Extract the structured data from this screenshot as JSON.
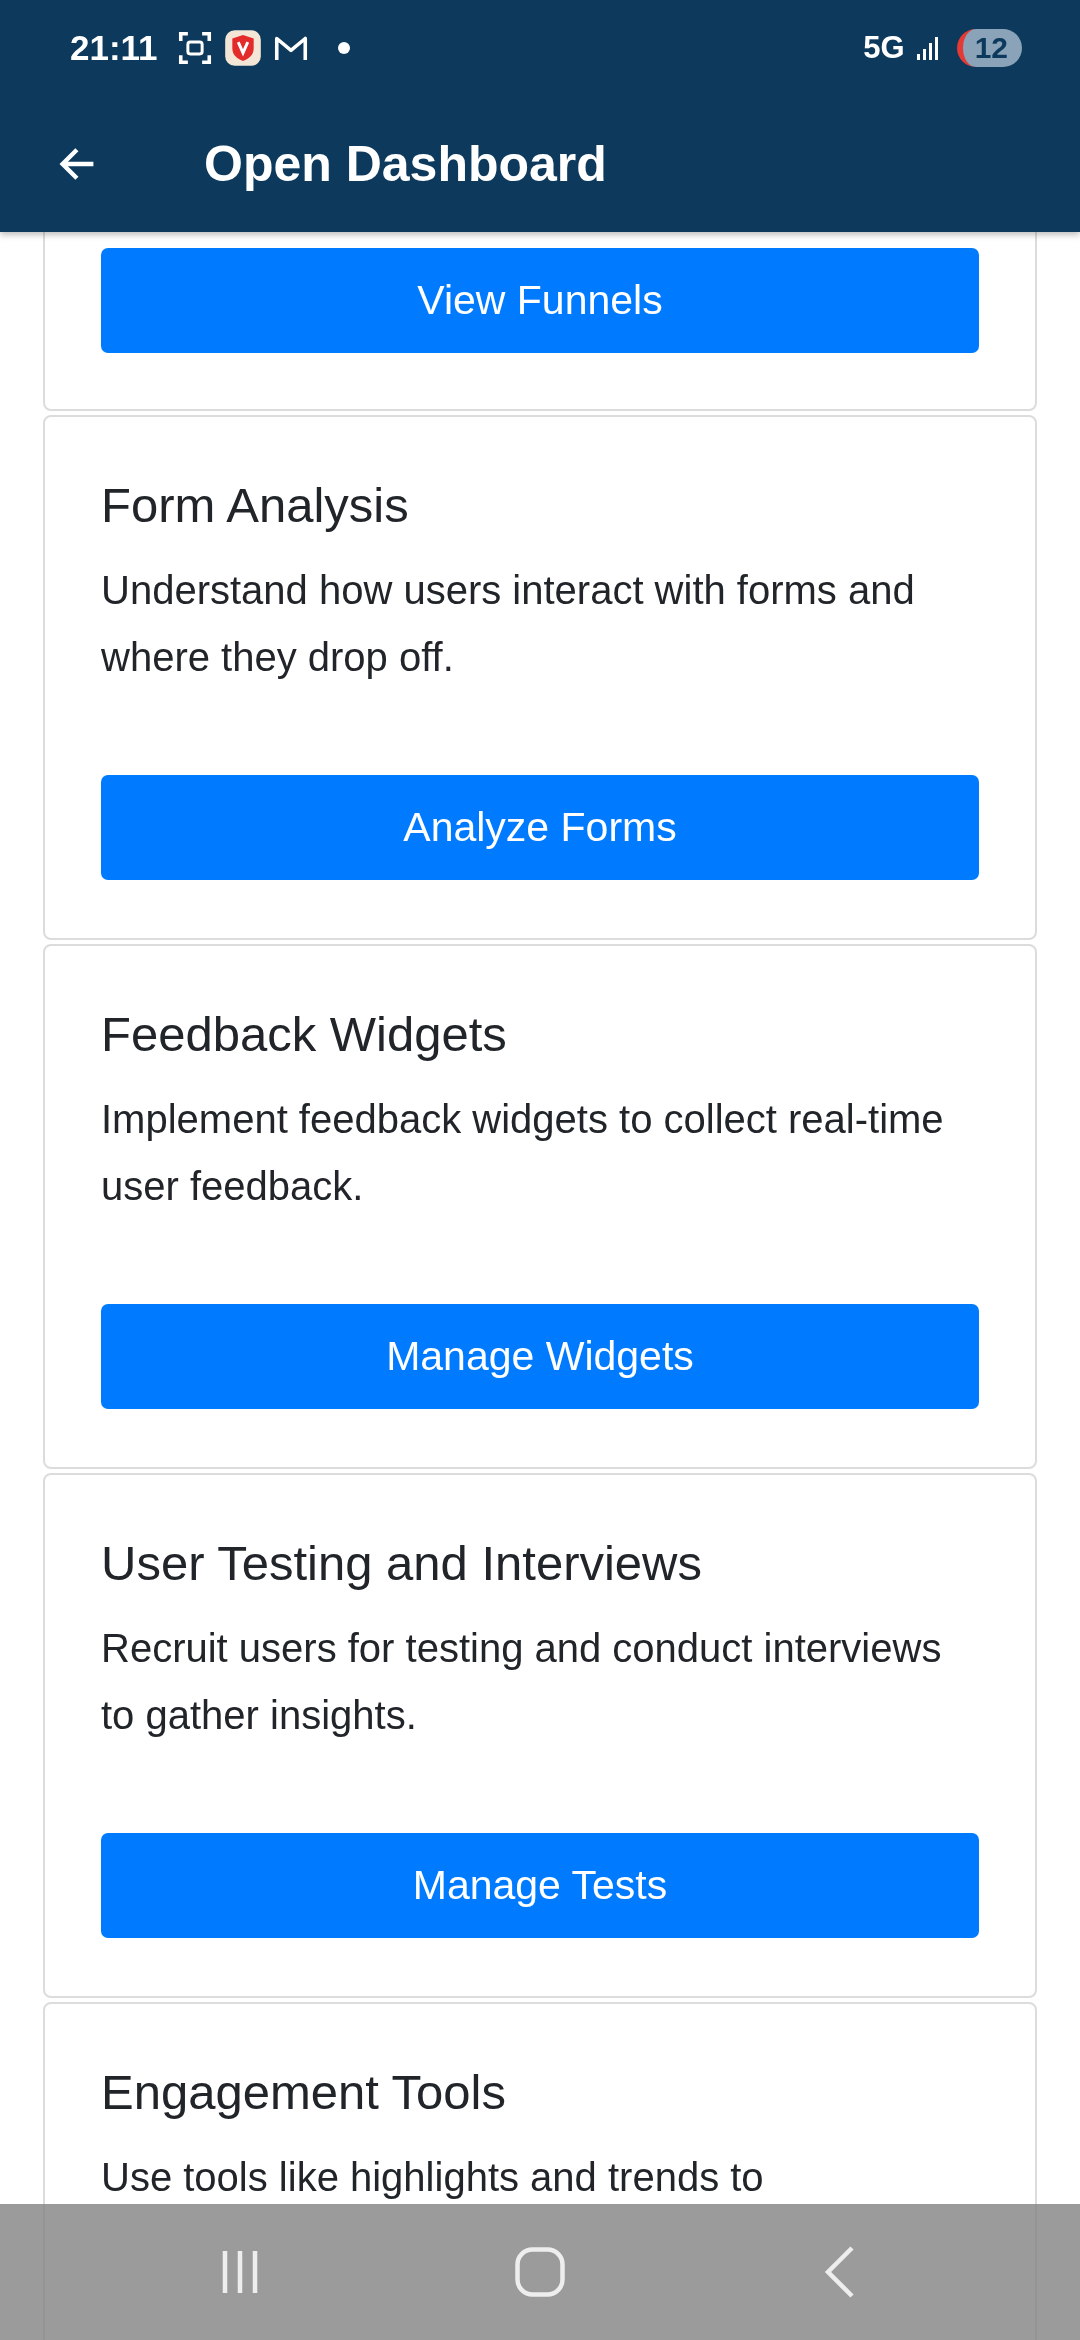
{
  "status_bar": {
    "time": "21:11",
    "network": "5G",
    "battery": "12"
  },
  "app_bar": {
    "title": "Open Dashboard"
  },
  "cards": [
    {
      "button": "View Funnels"
    },
    {
      "title": "Form Analysis",
      "description": "Understand how users interact with forms and where they drop off.",
      "button": "Analyze Forms"
    },
    {
      "title": "Feedback Widgets",
      "description": "Implement feedback widgets to collect real-time user feedback.",
      "button": "Manage Widgets"
    },
    {
      "title": "User Testing and Interviews",
      "description": "Recruit users for testing and conduct interviews to gather insights.",
      "button": "Manage Tests"
    },
    {
      "title": "Engagement Tools",
      "description": "Use tools like highlights and trends to"
    }
  ]
}
